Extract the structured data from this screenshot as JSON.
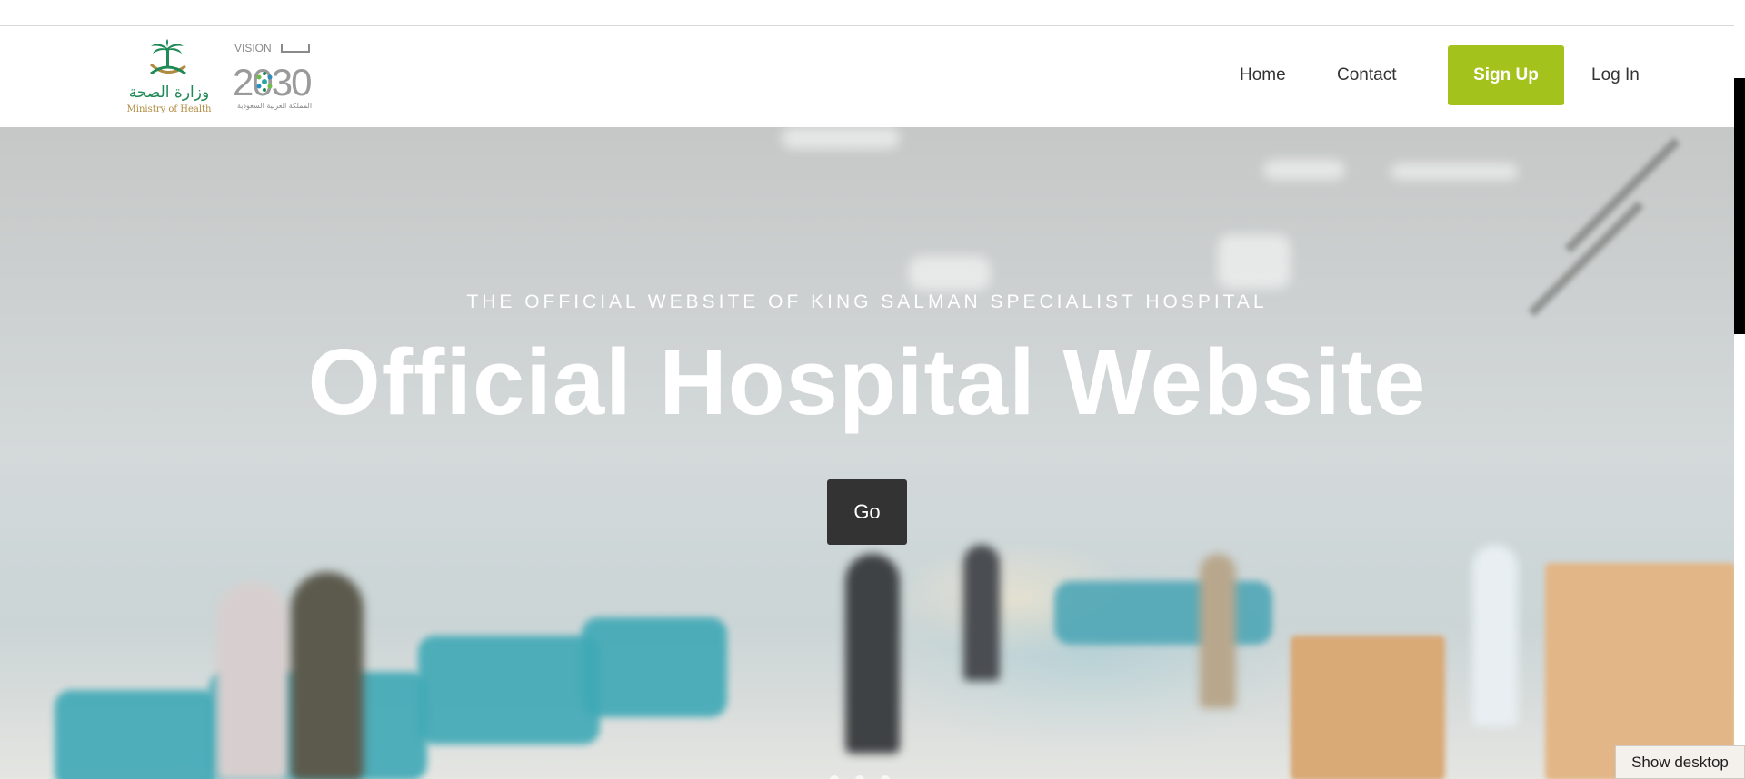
{
  "header": {
    "logo_moh_arabic": "وزارة الصحة",
    "logo_moh_english": "Ministry of Health",
    "logo_vision_top": "VISION",
    "logo_vision_year": "2030",
    "logo_vision_arabic": "المملكة العربية السعودية",
    "nav": {
      "home": "Home",
      "contact": "Contact",
      "signup": "Sign Up",
      "login": "Log In"
    }
  },
  "hero": {
    "kicker": "THE OFFICIAL WEBSITE OF KING SALMAN SPECIALIST HOSPITAL",
    "title": "Official Hospital Website",
    "go_label": "Go"
  },
  "overlay": {
    "show_desktop": "Show desktop"
  },
  "colors": {
    "signup_bg": "#a3c21b",
    "go_bg": "#333333",
    "moh_green": "#1f8a55",
    "moh_gold": "#b08a3e",
    "vision_gray": "#8a8a8a"
  },
  "icons": [
    "moh-palm-logo",
    "vision-2030-logo"
  ]
}
